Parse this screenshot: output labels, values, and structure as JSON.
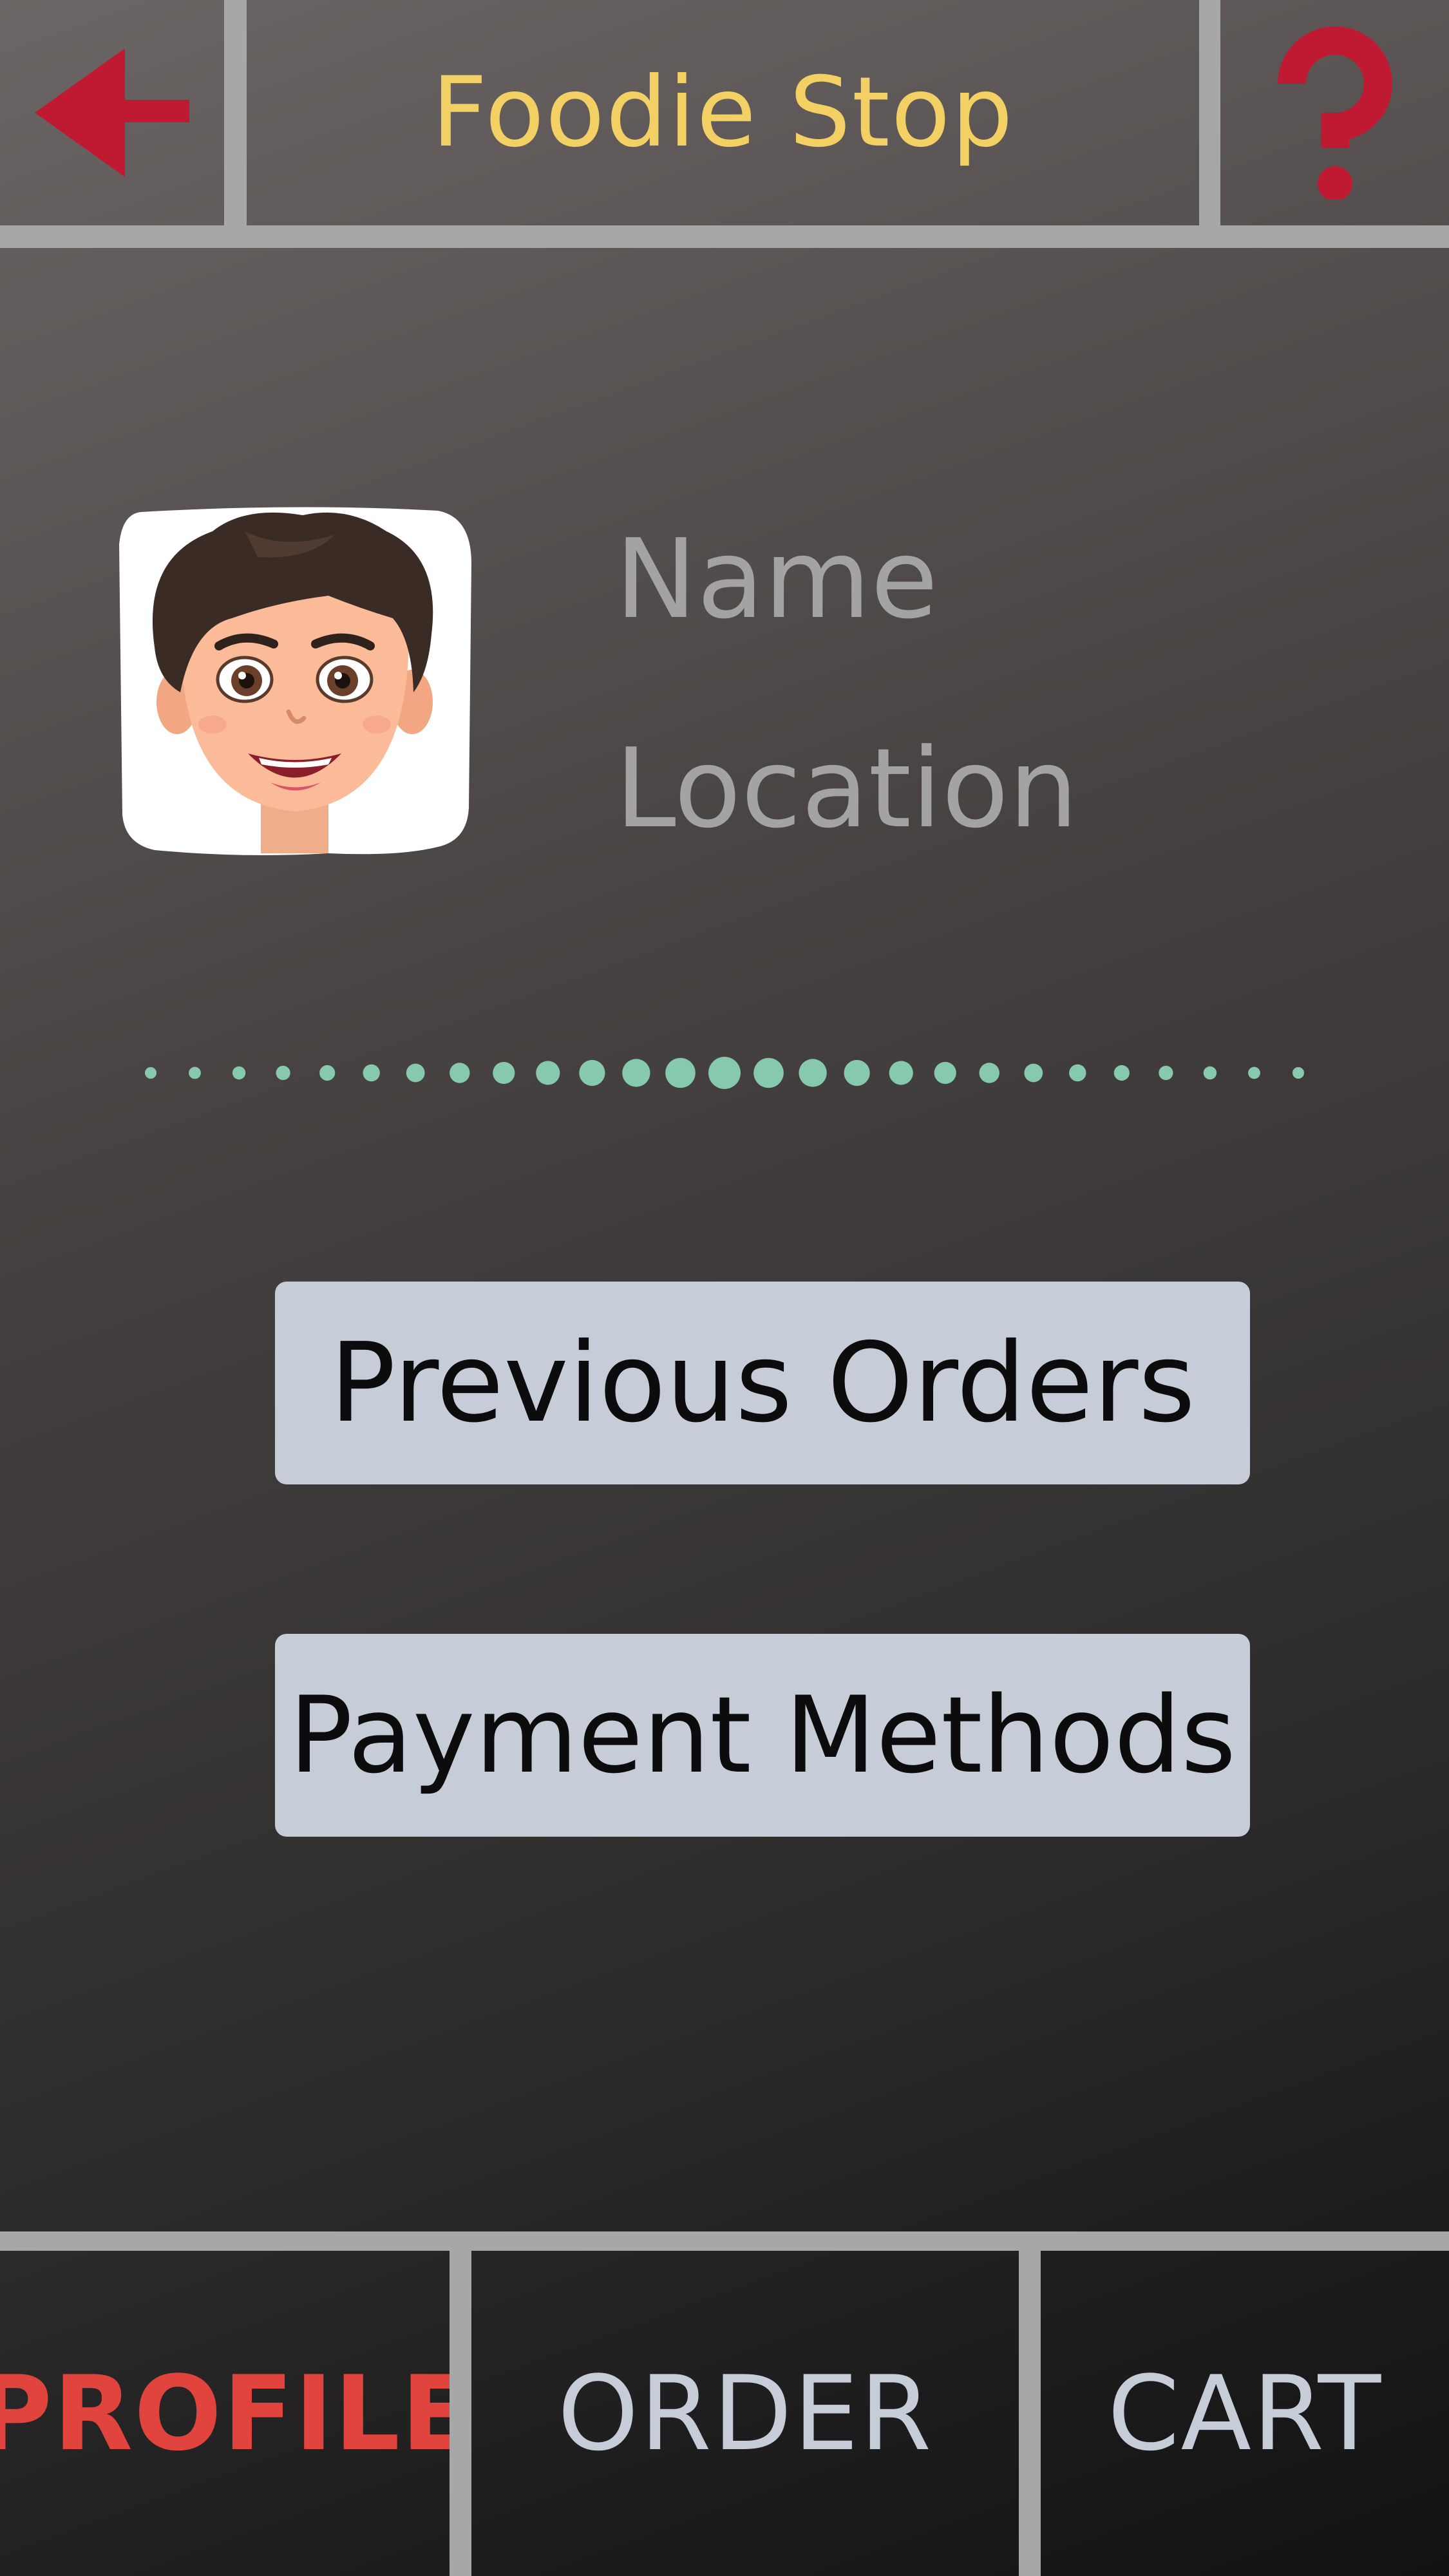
{
  "header": {
    "title": "Foodie Stop",
    "back_icon": "arrow-left-icon",
    "help_icon": "question-mark-icon"
  },
  "profile": {
    "avatar_icon": "cartoon-avatar-icon",
    "name": "Name",
    "location": "Location"
  },
  "actions": {
    "previous_orders": "Previous Orders",
    "payment_methods": "Payment Methods"
  },
  "nav": {
    "tabs": [
      {
        "label": "PROFILE",
        "active": true
      },
      {
        "label": "ORDER",
        "active": false
      },
      {
        "label": "CART",
        "active": false
      }
    ]
  },
  "colors": {
    "title": "#f2d064",
    "icon_red": "#c01a33",
    "dot_green": "#86c9ae",
    "button_bg": "#c6cdd8",
    "active_tab": "#e0443c",
    "divider": "#a7a7a7"
  }
}
